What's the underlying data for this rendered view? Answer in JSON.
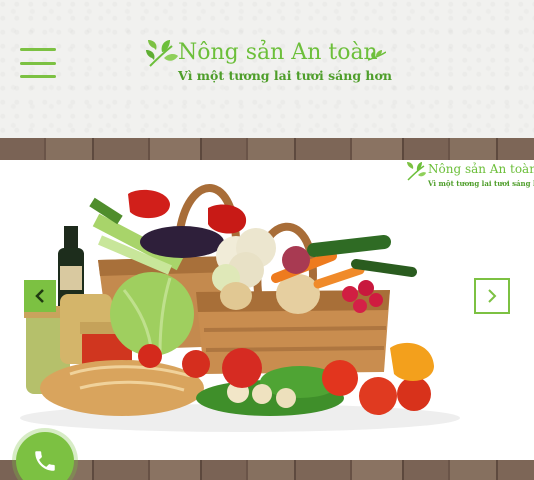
{
  "header": {
    "logo_title": "Nông sản An toàn",
    "logo_subtitle": "Vì một tương lai tươi sáng hơn",
    "menu_icon": "hamburger-icon"
  },
  "banner": {
    "watermark_title": "Nông sản An toàn",
    "watermark_subtitle": "Vì một tương lai tươi sáng hơn",
    "image": "vegetable-basket-photo",
    "prev_icon": "chevron-left-icon",
    "next_icon": "chevron-right-icon"
  },
  "contact": {
    "call_icon": "phone-icon"
  },
  "colors": {
    "brand_green": "#7cc142",
    "dark_green": "#4e9e2a",
    "wood": "#7a6355"
  }
}
